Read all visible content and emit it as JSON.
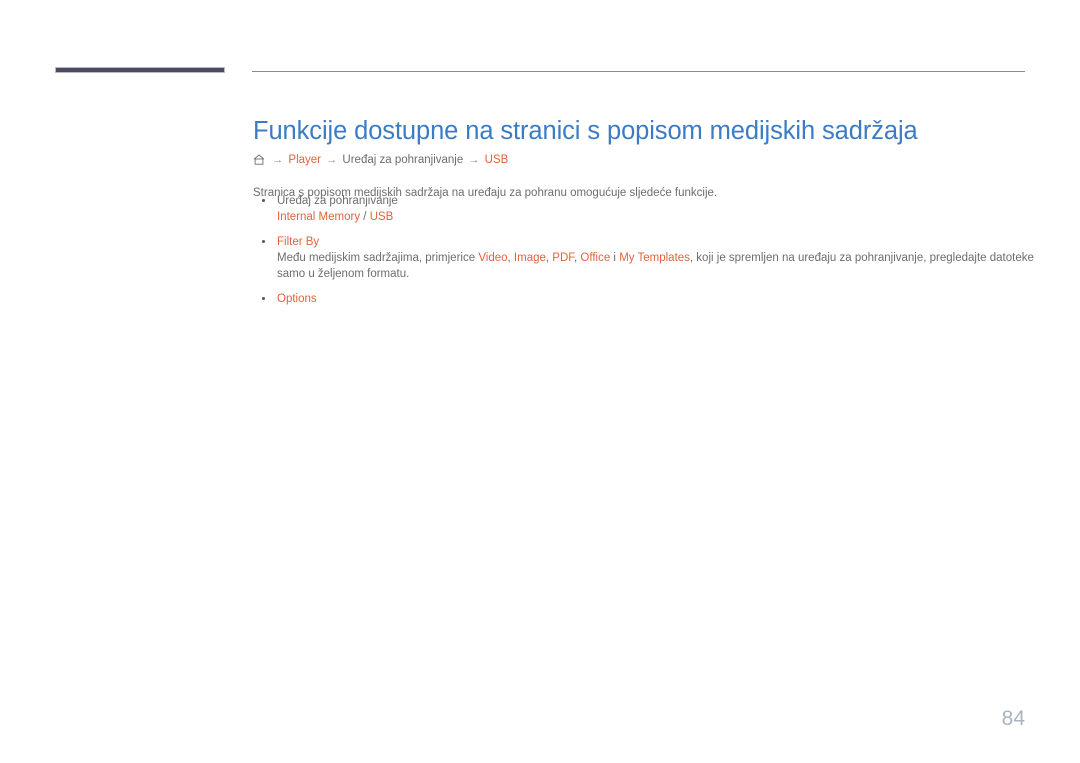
{
  "document": {
    "title": "Funkcije dostupne na stranici s popisom medijskih sadržaja",
    "page_number": "84"
  },
  "breadcrumb": {
    "home_icon": "home-icon",
    "arrow": "→",
    "items": [
      {
        "label": "Player",
        "style": "accent"
      },
      {
        "label": "Uređaj za pohranjivanje",
        "style": "plain"
      },
      {
        "label": "USB",
        "style": "accent"
      }
    ]
  },
  "intro": {
    "text": "Stranica s popisom medijskih sadržaja na uređaju za pohranu omogućuje sljedeće funkcije."
  },
  "bullets": [
    {
      "head": "Uređaj za pohranjivanje",
      "head_style": "plain",
      "sub": {
        "part1": "Internal Memory",
        "sep": " / ",
        "part2": "USB"
      }
    },
    {
      "head": "Filter By",
      "head_style": "accent",
      "body": {
        "lead": "Među medijskim sadržajima, primjerice ",
        "term1": "Video",
        "sep1": ", ",
        "term2": "Image",
        "sep2": ", ",
        "term3": "PDF",
        "sep3": ", ",
        "term4": "Office",
        "sep4": " i ",
        "term5": "My Templates",
        "tail": ", koji je spremljen na uređaju za pohranjivanje, pregledajte datoteke samo u željenom formatu."
      }
    },
    {
      "head": "Options",
      "head_style": "accent"
    }
  ],
  "colors": {
    "title_blue": "#3b7cc4",
    "accent_orange": "#e0633e",
    "body_gray": "#6d6d6d",
    "header_bar_navy": "#4a4a63",
    "page_number_gray": "#a8b4c0"
  }
}
